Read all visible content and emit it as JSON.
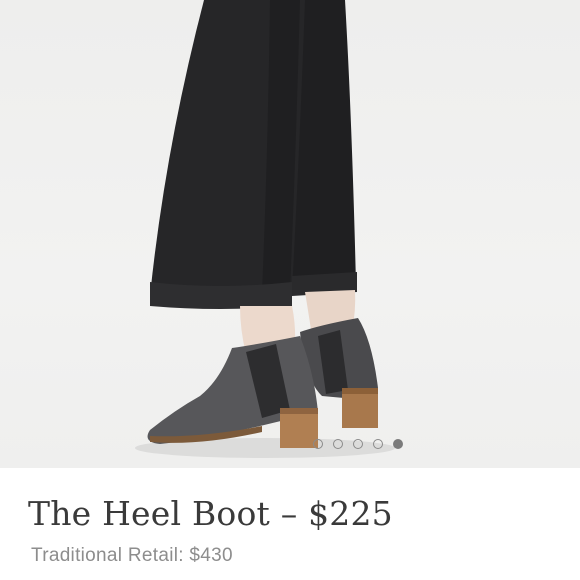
{
  "product": {
    "title": "The Heel Boot – $225",
    "traditional_retail": "Traditional Retail: $430",
    "image": {
      "subject": "product-photo",
      "slides_total": 5,
      "active_slide": 5
    }
  }
}
